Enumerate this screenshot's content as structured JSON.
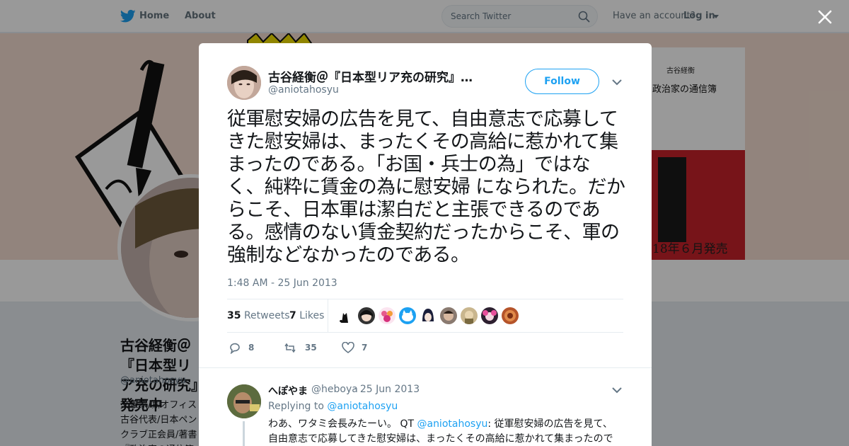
{
  "nav": {
    "home_label": "Home",
    "about_label": "About",
    "search_placeholder": "Search Twitter",
    "have_account": "Have an account?",
    "login_label": "Log in",
    "brand_color": "#1da1f2"
  },
  "banner": {
    "book_author": "古谷経衡",
    "book_title": "政治家の通信簿",
    "release_text": "18年６月発売"
  },
  "profile": {
    "name": "古谷経衡＠『日本型リア充の研究』発売中",
    "handle": "@aniotahosyu",
    "bio": "文筆家/㈱オフィス古谷代表/日本ペンクラブ正会員/著書『政治家の通信簿』『左翼も右翼もウソばかり』"
  },
  "tweet": {
    "author_name": "古谷経衡＠『日本型リア充の研究』…",
    "author_handle": "@aniotahosyu",
    "follow_label": "Follow",
    "text": "従軍慰安婦の広告を見て、自由意志で応募してきた慰安婦は、まったくその高給に惹かれて集まったのである。「お国・兵士の為」ではなく、純粋に賃金の為に慰安婦 になられた。だからこそ、日本軍は潔白だと主張できるのである。感情のない賃金契約だったからこそ、軍の強制などなかったのである。",
    "timestamp": "1:48 AM - 25 Jun 2013",
    "retweets_count": "35",
    "retweets_label": "Retweets",
    "likes_count": "7",
    "likes_label": "Likes",
    "liker_avatars": [
      "cat-silhouette",
      "face-dark",
      "flower-pink",
      "cat-blue",
      "anime-dark",
      "face-brown",
      "face-tan",
      "anime-pink",
      "face-orange"
    ],
    "actions": {
      "replies": "8",
      "retweets": "35",
      "likes": "7"
    }
  },
  "reply": {
    "name": "へぽやま",
    "handle": "@heboya",
    "date": "· 25 Jun 2013",
    "replying_prefix": "Replying to",
    "replying_handle": "@aniotahosyu",
    "text_before": "わあ、ワタミ会長みたーい。 QT ",
    "text_link": "@aniotahosyu",
    "text_after": ": 従軍慰安婦の広告を見て、自由意志で応募してきた慰安婦は、まったくその高給に惹かれて集まったのであ"
  }
}
